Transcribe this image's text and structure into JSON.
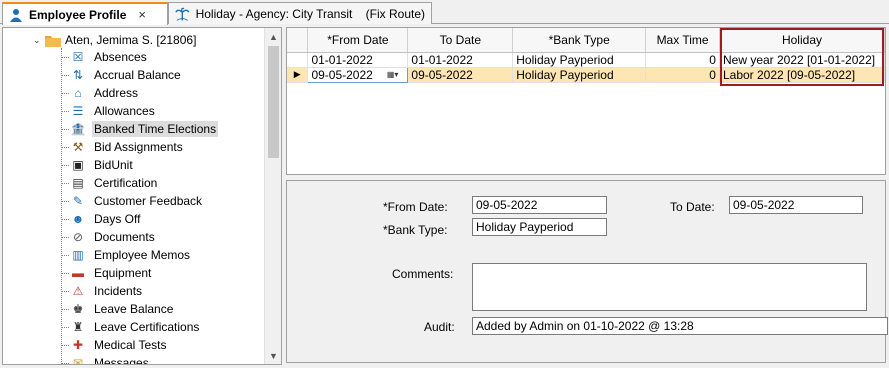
{
  "tabs": [
    {
      "label": "Employee Profile",
      "close": "×"
    },
    {
      "label": "Holiday - Agency: City Transit    (Fix Route)"
    }
  ],
  "tree": {
    "root_label": "Aten, Jemima S. [21806]",
    "items": [
      {
        "label": "Absences",
        "icon": "absences-icon"
      },
      {
        "label": "Accrual Balance",
        "icon": "accrual-icon"
      },
      {
        "label": "Address",
        "icon": "house-icon"
      },
      {
        "label": "Allowances",
        "icon": "allowances-icon"
      },
      {
        "label": "Banked Time Elections",
        "icon": "bank-icon",
        "selected": true
      },
      {
        "label": "Bid Assignments",
        "icon": "gavel-icon"
      },
      {
        "label": "BidUnit",
        "icon": "bidunit-icon"
      },
      {
        "label": "Certification",
        "icon": "certificate-icon"
      },
      {
        "label": "Customer Feedback",
        "icon": "feedback-icon"
      },
      {
        "label": "Days Off",
        "icon": "days-off-icon"
      },
      {
        "label": "Documents",
        "icon": "paperclip-icon"
      },
      {
        "label": "Employee Memos",
        "icon": "memo-icon"
      },
      {
        "label": "Equipment",
        "icon": "toolbox-icon"
      },
      {
        "label": "Incidents",
        "icon": "warning-icon"
      },
      {
        "label": "Leave Balance",
        "icon": "leave-balance-icon"
      },
      {
        "label": "Leave Certifications",
        "icon": "leave-cert-icon"
      },
      {
        "label": "Medical Tests",
        "icon": "medical-icon"
      },
      {
        "label": "Messages",
        "icon": "envelope-icon"
      }
    ]
  },
  "grid": {
    "columns": [
      "*From Date",
      "To Date",
      "*Bank Type",
      "Max Time",
      "Holiday"
    ],
    "rows": [
      {
        "from": "01-01-2022",
        "to": "01-01-2022",
        "bank_type": "Holiday Payperiod",
        "max_time": "0",
        "holiday": "New year 2022 [01-01-2022]"
      },
      {
        "from": "09-05-2022",
        "to": "09-05-2022",
        "bank_type": "Holiday Payperiod",
        "max_time": "0",
        "holiday": "Labor 2022 [09-05-2022]"
      }
    ]
  },
  "detail": {
    "from_date_label": "*From Date:",
    "from_date_value": "09-05-2022",
    "to_date_label": "To Date:",
    "to_date_value": "09-05-2022",
    "bank_type_label": "*Bank Type:",
    "bank_type_value": "Holiday Payperiod",
    "comments_label": "Comments:",
    "comments_value": "",
    "audit_label": "Audit:",
    "audit_value": "Added by Admin on 01-10-2022 @ 13:28"
  },
  "colors": {
    "accent_tab": "#f08a1c",
    "current_row": "#fde5b4",
    "highlight_box": "#9b1c22"
  }
}
